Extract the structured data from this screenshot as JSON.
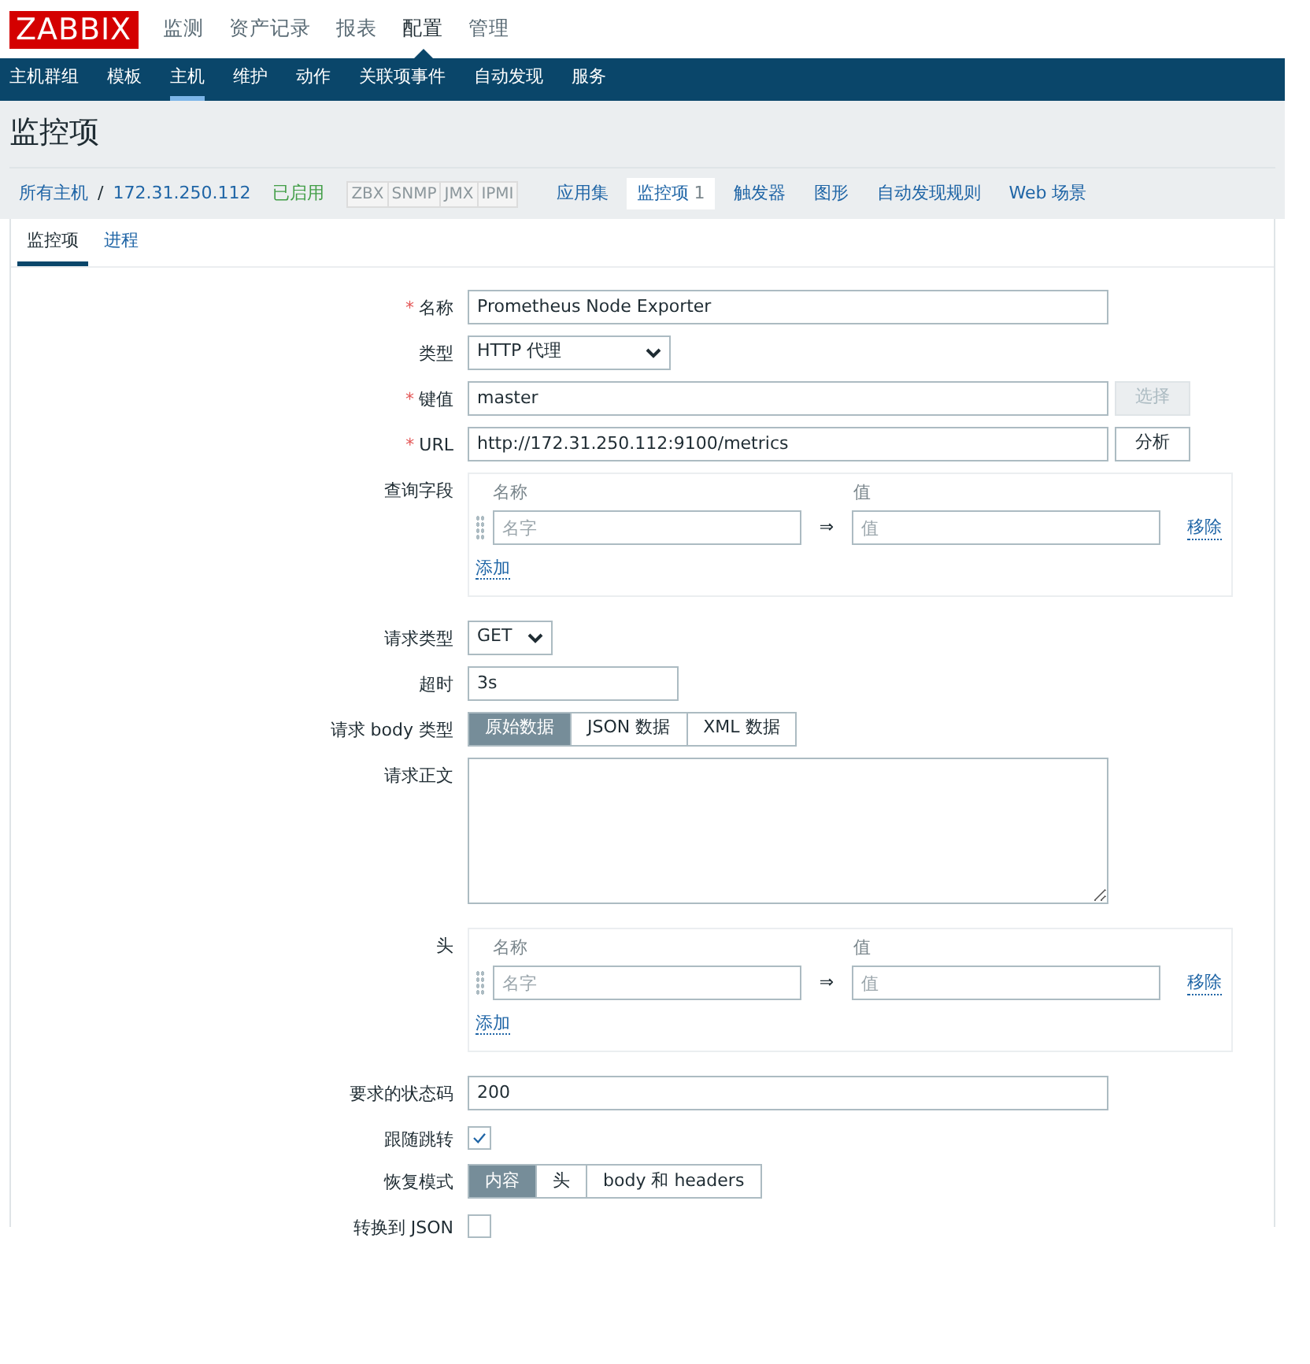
{
  "logo": "ZABBIX",
  "main_menu": [
    {
      "label": "监测",
      "selected": false
    },
    {
      "label": "资产记录",
      "selected": false
    },
    {
      "label": "报表",
      "selected": false
    },
    {
      "label": "配置",
      "selected": true
    },
    {
      "label": "管理",
      "selected": false
    }
  ],
  "sub_menu": [
    {
      "label": "主机群组",
      "selected": false
    },
    {
      "label": "模板",
      "selected": false
    },
    {
      "label": "主机",
      "selected": true
    },
    {
      "label": "维护",
      "selected": false
    },
    {
      "label": "动作",
      "selected": false
    },
    {
      "label": "关联项事件",
      "selected": false
    },
    {
      "label": "自动发现",
      "selected": false
    },
    {
      "label": "服务",
      "selected": false
    }
  ],
  "page_title": "监控项",
  "breadcrumb": {
    "root": "所有主机",
    "separator": "/",
    "host": "172.31.250.112",
    "status": "已启用",
    "availability": [
      {
        "label": "ZBX",
        "available": false
      },
      {
        "label": "SNMP",
        "available": false
      },
      {
        "label": "JMX",
        "available": false
      },
      {
        "label": "IPMI",
        "available": false
      }
    ],
    "tabs": [
      {
        "label": "应用集",
        "selected": false
      },
      {
        "label": "监控项",
        "count": "1",
        "selected": true
      },
      {
        "label": "触发器",
        "selected": false
      },
      {
        "label": "图形",
        "selected": false
      },
      {
        "label": "自动发现规则",
        "selected": false
      },
      {
        "label": "Web 场景",
        "selected": false
      }
    ]
  },
  "form_tabs": [
    {
      "label": "监控项",
      "selected": true
    },
    {
      "label": "进程",
      "selected": false
    }
  ],
  "form": [
    {
      "kind": "text",
      "label": "名称",
      "required": true,
      "required_mark": "*",
      "value": "Prometheus Node Exporter"
    },
    {
      "kind": "select",
      "label": "类型",
      "value": "HTTP 代理"
    },
    {
      "kind": "text",
      "label": "键值",
      "required": true,
      "required_mark": "*",
      "value": "master",
      "button": {
        "label": "选择",
        "disabled": true
      }
    },
    {
      "kind": "text",
      "label": "URL",
      "required": true,
      "required_mark": "*",
      "value": "http://172.31.250.112:9100/metrics",
      "button": {
        "label": "分析",
        "disabled": false
      }
    },
    {
      "kind": "pairs",
      "label": "查询字段",
      "name_header": "名称",
      "value_header": "值",
      "name_placeholder": "名字",
      "arrow": "⇒",
      "value_placeholder": "值",
      "remove": "移除",
      "add": "添加"
    },
    {
      "kind": "select_short",
      "label": "请求类型",
      "value": "GET"
    },
    {
      "kind": "short",
      "label": "超时",
      "value": "3s"
    },
    {
      "kind": "segmented",
      "label": "请求 body 类型",
      "options": [
        {
          "label": "原始数据",
          "selected": true
        },
        {
          "label": "JSON 数据",
          "selected": false
        },
        {
          "label": "XML 数据",
          "selected": false
        }
      ]
    },
    {
      "kind": "textarea",
      "label": "请求正文"
    },
    {
      "kind": "pairs",
      "label": "头",
      "name_header": "名称",
      "value_header": "值",
      "name_placeholder": "名字",
      "arrow": "⇒",
      "value_placeholder": "值",
      "remove": "移除",
      "add": "添加"
    },
    {
      "kind": "text",
      "label": "要求的状态码",
      "value": "200"
    },
    {
      "kind": "checkbox",
      "label": "跟随跳转",
      "checked": true
    },
    {
      "kind": "segmented",
      "label": "恢复模式",
      "options": [
        {
          "label": "内容",
          "selected": true
        },
        {
          "label": "头",
          "selected": false
        },
        {
          "label": "body 和 headers",
          "selected": false
        }
      ]
    },
    {
      "kind": "checkbox",
      "label": "转换到 JSON",
      "checked": false
    }
  ]
}
